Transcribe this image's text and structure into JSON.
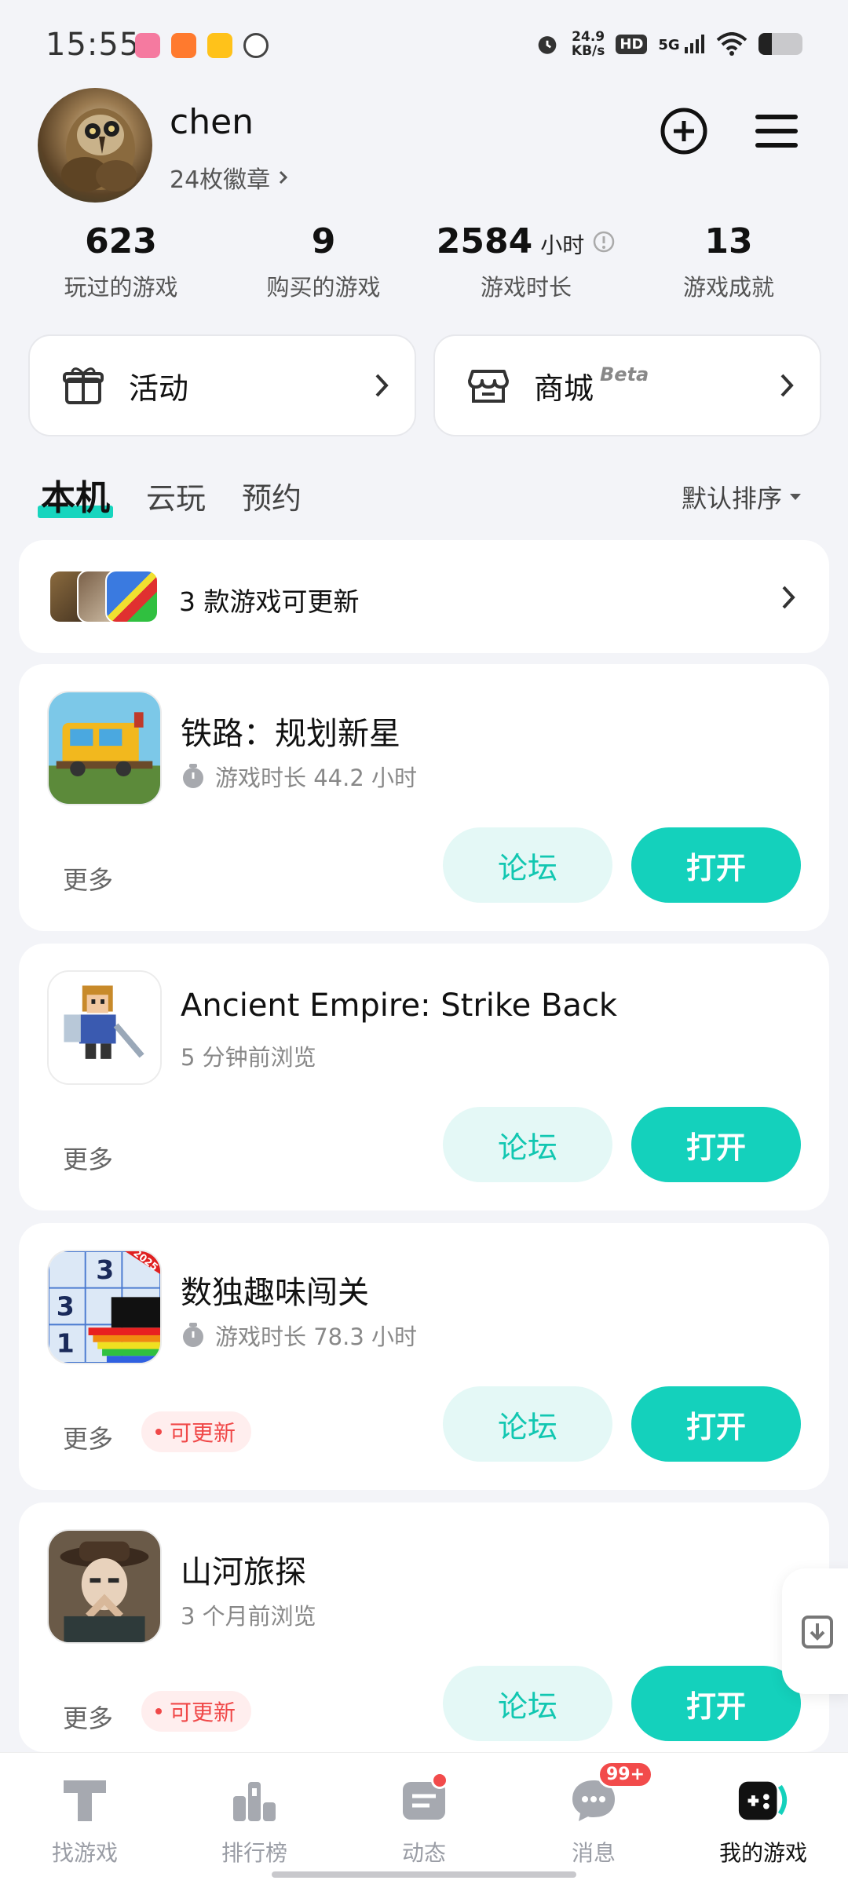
{
  "status_bar": {
    "time": "15:55",
    "net_speed_value": "24.9",
    "net_speed_unit": "KB/s",
    "hd": "HD",
    "signal": "5G",
    "battery_level": 0.3,
    "app_icons": [
      "bilibili-icon",
      "xiaomi-app-icon",
      "taxi-app-icon",
      "clock-app-icon"
    ]
  },
  "profile": {
    "username": "chen",
    "badges": "24枚徽章",
    "add_icon": "plus-circle-icon",
    "menu_icon": "menu-icon"
  },
  "stats": [
    {
      "value": "623",
      "unit": "",
      "label": "玩过的游戏"
    },
    {
      "value": "9",
      "unit": "",
      "label": "购买的游戏"
    },
    {
      "value": "2584",
      "unit": "小时",
      "label": "游戏时长"
    },
    {
      "value": "13",
      "unit": "",
      "label": "游戏成就"
    }
  ],
  "quick_cards": {
    "activity": {
      "label": "活动",
      "icon": "gift-icon"
    },
    "store": {
      "label": "商城",
      "beta": "Beta",
      "icon": "store-icon"
    }
  },
  "tabs": [
    "本机",
    "云玩",
    "预约"
  ],
  "sort_label": "默认排序",
  "update_bar": {
    "text": "3 款游戏可更新"
  },
  "games": [
    {
      "name": "铁路：规划新星",
      "meta": "游戏时长 44.2 小时",
      "meta_icon": "stopwatch-icon",
      "more": "更多",
      "badge": "",
      "forum": "论坛",
      "open": "打开"
    },
    {
      "name": "Ancient Empire: Strike Back",
      "meta": "5 分钟前浏览",
      "meta_icon": "",
      "more": "更多",
      "badge": "",
      "forum": "论坛",
      "open": "打开"
    },
    {
      "name": "数独趣味闯关",
      "meta": "游戏时长 78.3 小时",
      "meta_icon": "stopwatch-icon",
      "more": "更多",
      "badge": "可更新",
      "forum": "论坛",
      "open": "打开",
      "icon_digits": [
        "3",
        "3",
        "1"
      ],
      "icon_ribbon": "2025"
    },
    {
      "name": "山河旅探",
      "meta": "3 个月前浏览",
      "meta_icon": "",
      "more": "更多",
      "badge": "可更新",
      "forum": "论坛",
      "open": "打开"
    }
  ],
  "bottom_nav": [
    {
      "label": "找游戏",
      "icon": "find-games-icon"
    },
    {
      "label": "排行榜",
      "icon": "ranking-icon"
    },
    {
      "label": "动态",
      "icon": "feed-icon"
    },
    {
      "label": "消息",
      "icon": "message-icon",
      "count": "99+"
    },
    {
      "label": "我的游戏",
      "icon": "my-games-icon",
      "active": true
    }
  ],
  "colors": {
    "accent": "#14D1BC",
    "update_red": "#F04848"
  }
}
